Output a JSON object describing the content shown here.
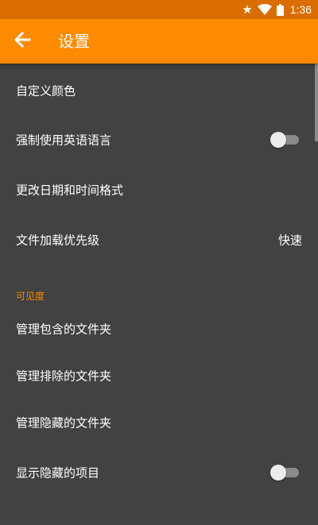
{
  "status_bar": {
    "time": "1:36",
    "icons": [
      "star-icon",
      "wifi-icon",
      "battery-icon"
    ]
  },
  "app_bar": {
    "back_icon": "arrow-left-icon",
    "title": "设置"
  },
  "settings": {
    "custom_colors": {
      "label": "自定义颜色"
    },
    "force_english": {
      "label": "强制使用英语语言",
      "enabled": false
    },
    "date_time_format": {
      "label": "更改日期和时间格式"
    },
    "file_loading_priority": {
      "label": "文件加载优先级",
      "value": "快速"
    }
  },
  "visibility": {
    "header": "可见度",
    "manage_included_folders": {
      "label": "管理包含的文件夹"
    },
    "manage_excluded_folders": {
      "label": "管理排除的文件夹"
    },
    "manage_hidden_folders": {
      "label": "管理隐藏的文件夹"
    },
    "show_hidden_items": {
      "label": "显示隐藏的项目",
      "enabled": false
    }
  },
  "colors": {
    "status_bar": "#d96d00",
    "app_bar": "#fd8a00",
    "accent": "#fd8a00",
    "background": "#424242",
    "text": "#ffffff"
  }
}
